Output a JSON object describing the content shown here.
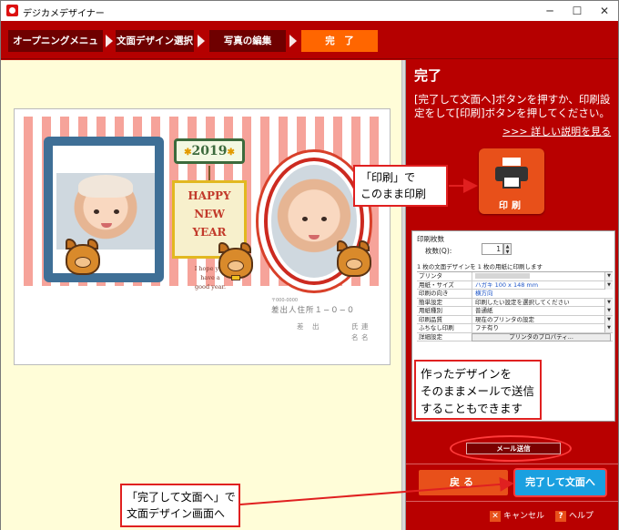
{
  "window": {
    "title": "デジカメデザイナー",
    "controls": {
      "minimize": "─",
      "maximize": "☐",
      "close": "✕"
    }
  },
  "steps": [
    {
      "label": "オープニングメニュー",
      "active": false
    },
    {
      "label": "文面デザイン選択",
      "active": false
    },
    {
      "label": "写真の編集",
      "active": false
    },
    {
      "label": "完　了",
      "active": true
    }
  ],
  "card": {
    "year": "2019",
    "greeting_lines": [
      "HAPPY",
      "NEW",
      "YEAR"
    ],
    "hope_lines": [
      "I hope you",
      "have a",
      "good year."
    ],
    "postal_code": "〒000-0000",
    "address": "差出人住所１−０−０",
    "sender": "差　出",
    "sender_name_1": "氏名",
    "sender_name_2": "連名"
  },
  "panel": {
    "title": "完了",
    "description": "[完了して文面へ]ボタンを押すか、印刷設定をして[印刷]ボタンを押してください。",
    "details_link": ">>> 詳しい説明を見る",
    "print_button": "印刷",
    "settings": {
      "heading": "印刷枚数",
      "copies_label": "枚数(Q):",
      "copies_value": "1",
      "note": "1 枚の文面デザインを 1 枚の用紙に印刷します",
      "rows": [
        {
          "key": "プリンタ",
          "value": "",
          "blurred": true,
          "dropdown": true
        },
        {
          "key": "用紙・サイズ",
          "value": "ハガキ 100 x 148 mm",
          "blue": true,
          "dropdown": true
        },
        {
          "key": "印刷の向き",
          "value": "横方向",
          "blue": true,
          "dropdown": false
        },
        {
          "key": "簡単設定",
          "value": "印刷したい設定を選択してください",
          "dropdown": true
        },
        {
          "key": "用紙種別",
          "value": "普通紙",
          "dropdown": true
        },
        {
          "key": "印刷品質",
          "value": "現在のプリンタの設定",
          "dropdown": true
        },
        {
          "key": "ふちなし印刷",
          "value": "フチ有り",
          "dropdown": true
        },
        {
          "key": "詳細設定",
          "value": "プリンタのプロパティ...",
          "button": true
        }
      ]
    },
    "mail_button": "メール送信",
    "back_button": "戻る",
    "done_button": "完了して文面へ",
    "cancel_label": "キャンセル",
    "help_label": "ヘルプ"
  },
  "callouts": {
    "print": [
      "「印刷」で",
      "このまま印刷"
    ],
    "mail": [
      "作ったデザインを",
      "そのままメールで送信",
      "することもできます"
    ],
    "done": [
      "「完了して文面へ」で",
      "文面デザイン画面へ"
    ]
  },
  "colors": {
    "accent_red": "#b80000",
    "orange": "#e8501a",
    "blue": "#1aa0e0",
    "callout_border": "#e02020"
  }
}
